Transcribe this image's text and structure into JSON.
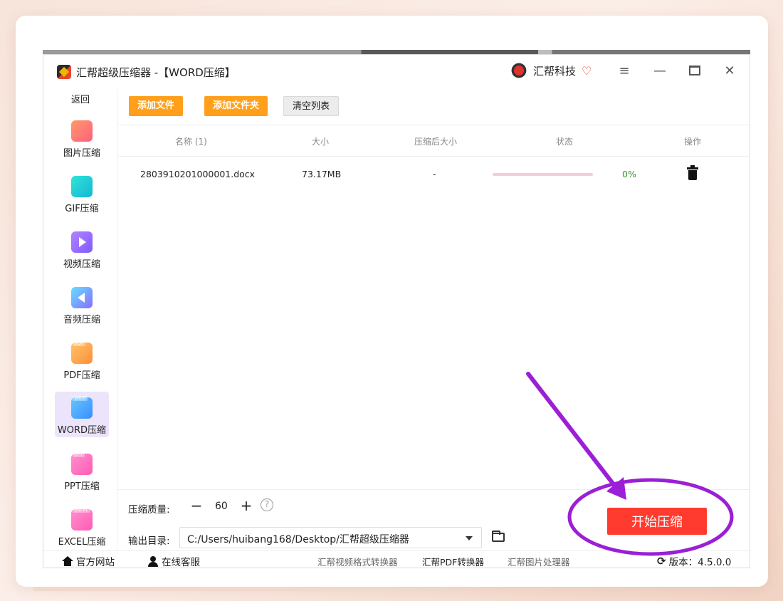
{
  "window": {
    "title": "汇帮超级压缩器 -【WORD压缩】",
    "brand": "汇帮科技",
    "icons": {
      "menu": "menu-icon",
      "min": "minimize-icon",
      "max": "maximize-icon",
      "close": "close-icon"
    }
  },
  "sidebar": {
    "back": "返回",
    "items": [
      {
        "label": "图片压缩",
        "icon": "image-icon"
      },
      {
        "label": "GIF压缩",
        "icon": "gif-icon"
      },
      {
        "label": "视频压缩",
        "icon": "video-icon"
      },
      {
        "label": "音频压缩",
        "icon": "audio-icon"
      },
      {
        "label": "PDF压缩",
        "icon": "pdf-icon",
        "tag": "PDF"
      },
      {
        "label": "WORD压缩",
        "icon": "word-icon",
        "tag": "Word",
        "active": true
      },
      {
        "label": "PPT压缩",
        "icon": "ppt-icon",
        "tag": "PPT"
      },
      {
        "label": "EXCEL压缩",
        "icon": "excel-icon",
        "tag": "EXCEL"
      }
    ]
  },
  "toolbar": {
    "add_file": "添加文件",
    "add_folder": "添加文件夹",
    "clear": "清空列表"
  },
  "table": {
    "headers": [
      "名称 (1)",
      "大小",
      "压缩后大小",
      "状态",
      "操作"
    ],
    "rows": [
      {
        "name": "2803910201000001.docx",
        "size": "73.17MB",
        "compressed": "-",
        "progress": 0,
        "percent": "0%"
      }
    ]
  },
  "settings": {
    "quality_label": "压缩质量:",
    "quality_minus": "−",
    "quality_value": "60",
    "quality_plus": "+",
    "help": "?",
    "output_label": "输出目录:",
    "output_path": "C:/Users/huibang168/Desktop/汇帮超级压缩器",
    "start": "开始压缩"
  },
  "footer": {
    "website": "官方网站",
    "support": "在线客服",
    "links": [
      "汇帮视频格式转换器",
      "汇帮PDF转换器",
      "汇帮图片处理器"
    ],
    "version": "版本：4.5.0.0",
    "refresh_icon": "refresh-icon"
  },
  "colors": {
    "accent_orange": "#ff9f1a",
    "start_red": "#ff3b2f",
    "annotation_purple": "#9b1fd6",
    "active_bg": "#ece4fa"
  }
}
